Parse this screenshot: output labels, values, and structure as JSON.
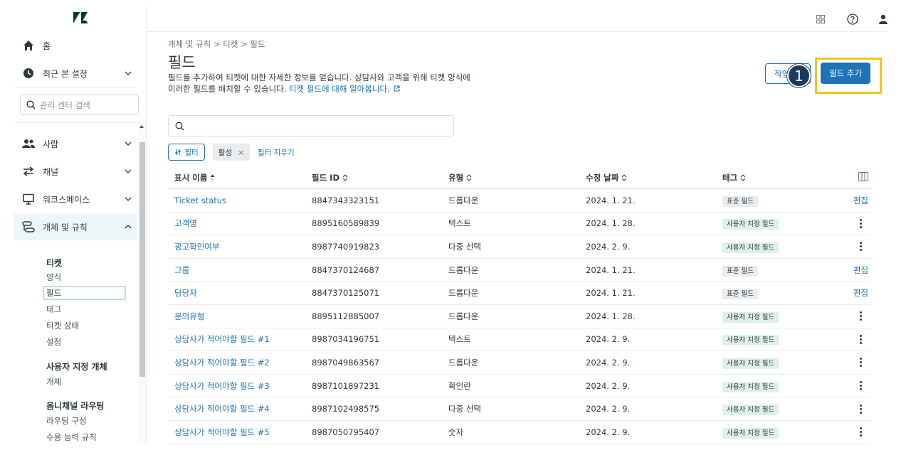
{
  "sidebar": {
    "home": "홈",
    "recent": "최근 본 설정",
    "search_placeholder": "관리 센터 검색",
    "people": "사람",
    "channels": "채널",
    "workspaces": "워크스페이스",
    "objects_rules": "개체 및 규칙",
    "tickets_head": "티켓",
    "ticket_items": [
      "양식",
      "필드",
      "태그",
      "티켓 상태",
      "설정"
    ],
    "custom_objects_head": "사용자 지정 개체",
    "custom_objects_items": [
      "개체"
    ],
    "omni_head": "옴니채널 라우팅",
    "omni_items": [
      "라우팅 구성",
      "수용 능력 규칙"
    ]
  },
  "breadcrumb": "개체 및 규칙 > 티켓 > 필드",
  "page_title": "필드",
  "description": "필드를 추가하여 티켓에 대한 자세한 정보를 얻습니다. 상담사와 고객을 위해 티켓 양식에 이러한 필드를 배치할 수 있습니다.",
  "description_link": "티켓 필드에 대해 알아봅니다.",
  "buttons": {
    "secondary": "작업",
    "primary": "필드 추가",
    "step": "1"
  },
  "filter": {
    "filter_label": "필터",
    "chip_label": "활성",
    "clear_label": "필터 지우기"
  },
  "table": {
    "headers": [
      "표시 이름",
      "필드 ID",
      "유형",
      "수정 날짜",
      "태그"
    ],
    "rows": [
      {
        "name": "Ticket status",
        "id": "8847343323151",
        "type": "드롭다운",
        "date": "2024. 1. 21.",
        "tag": "표준 필드",
        "action": "편집"
      },
      {
        "name": "고객명",
        "id": "8895160589839",
        "type": "텍스트",
        "date": "2024. 1. 28.",
        "tag": "사용자 지정 필드",
        "action": ""
      },
      {
        "name": "광고확인여부",
        "id": "8987740919823",
        "type": "다중 선택",
        "date": "2024. 2. 9.",
        "tag": "사용자 지정 필드",
        "action": ""
      },
      {
        "name": "그룹",
        "id": "8847370124687",
        "type": "드롭다운",
        "date": "2024. 1. 21.",
        "tag": "표준 필드",
        "action": "편집"
      },
      {
        "name": "담당자",
        "id": "8847370125071",
        "type": "드롭다운",
        "date": "2024. 1. 21.",
        "tag": "표준 필드",
        "action": "편집"
      },
      {
        "name": "문의유형",
        "id": "8895112885007",
        "type": "드롭다운",
        "date": "2024. 1. 28.",
        "tag": "사용자 지정 필드",
        "action": ""
      },
      {
        "name": "상담사가 적어야할 필드 #1",
        "id": "8987034196751",
        "type": "텍스트",
        "date": "2024. 2. 9.",
        "tag": "사용자 지정 필드",
        "action": ""
      },
      {
        "name": "상담사가 적어야할 필드 #2",
        "id": "8987049863567",
        "type": "드롭다운",
        "date": "2024. 2. 9.",
        "tag": "사용자 지정 필드",
        "action": ""
      },
      {
        "name": "상담사가 적어야할 필드 #3",
        "id": "8987101897231",
        "type": "확인란",
        "date": "2024. 2. 9.",
        "tag": "사용자 지정 필드",
        "action": ""
      },
      {
        "name": "상담사가 적어야할 필드 #4",
        "id": "8987102498575",
        "type": "다중 선택",
        "date": "2024. 2. 9.",
        "tag": "사용자 지정 필드",
        "action": ""
      },
      {
        "name": "상담사가 적어야할 필드 #5",
        "id": "8987050795407",
        "type": "숫자",
        "date": "2024. 2. 9.",
        "tag": "사용자 지정 필드",
        "action": ""
      }
    ]
  },
  "colors": {
    "accent": "#1f73b7",
    "highlight": "#f5c518",
    "badge": "#1b3a5c"
  }
}
